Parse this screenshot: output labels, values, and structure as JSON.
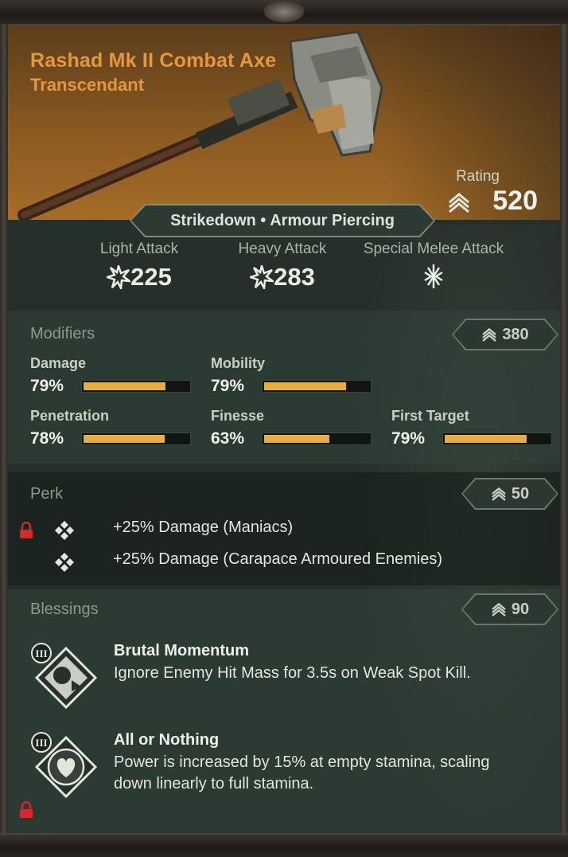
{
  "weapon": {
    "name": "Rashad Mk II Combat Axe",
    "rarity": "Transcendant",
    "rating_label": "Rating",
    "rating_value": "520",
    "traits": "Strikedown • Armour Piercing"
  },
  "attacks": [
    {
      "label": "Light Attack",
      "value": "225",
      "icon": "burst-icon"
    },
    {
      "label": "Heavy Attack",
      "value": "283",
      "icon": "burst-icon"
    },
    {
      "label": "Special Melee Attack",
      "value": "",
      "icon": "special-attack-icon"
    }
  ],
  "modifiers": {
    "title": "Modifiers",
    "score": "380",
    "items": [
      {
        "label": "Damage",
        "value": "79%",
        "fraction": 0.79
      },
      {
        "label": "Mobility",
        "value": "79%",
        "fraction": 0.79
      },
      {
        "label": "Penetration",
        "value": "78%",
        "fraction": 0.78
      },
      {
        "label": "Finesse",
        "value": "63%",
        "fraction": 0.63
      },
      {
        "label": "First Target",
        "value": "79%",
        "fraction": 0.79
      }
    ]
  },
  "perk": {
    "title": "Perk",
    "score": "50",
    "items": [
      {
        "text": "+25% Damage (Maniacs)",
        "locked": true
      },
      {
        "text": "+25% Damage (Carapace Armoured Enemies)",
        "locked": false
      }
    ]
  },
  "blessings": {
    "title": "Blessings",
    "score": "90",
    "items": [
      {
        "tier": "III",
        "name": "Brutal Momentum",
        "description": "Ignore Enemy Hit Mass for 3.5s on Weak Spot Kill.",
        "locked": false
      },
      {
        "tier": "III",
        "name": "All or Nothing",
        "description": "Power is increased by 15% at empty stamina, scaling down linearly to full stamina.",
        "locked": true
      }
    ]
  },
  "colors": {
    "accent_orange": "#e3973e",
    "bar_fill": "#e7ad3f",
    "lock_red": "#d9262b",
    "panel": "#25302b"
  }
}
